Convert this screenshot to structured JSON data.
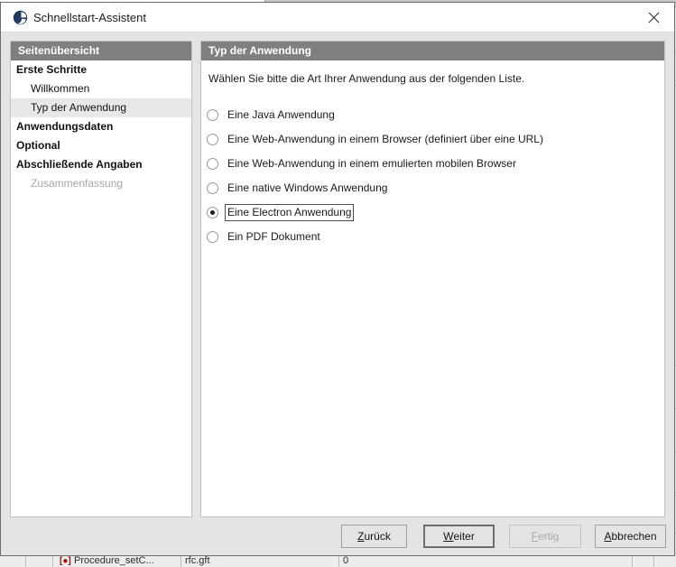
{
  "window": {
    "title": "Schnellstart-Assistent",
    "icon": "app-moon-icon",
    "close_label": "✕"
  },
  "sidebar": {
    "header": "Seitenübersicht",
    "items": [
      {
        "label": "Erste Schritte",
        "type": "group",
        "state": "normal"
      },
      {
        "label": "Willkommen",
        "type": "child",
        "state": "normal"
      },
      {
        "label": "Typ der Anwendung",
        "type": "child",
        "state": "current"
      },
      {
        "label": "Anwendungsdaten",
        "type": "group",
        "state": "normal"
      },
      {
        "label": "Optional",
        "type": "group",
        "state": "normal"
      },
      {
        "label": "Abschließende Angaben",
        "type": "group",
        "state": "normal"
      },
      {
        "label": "Zusammenfassung",
        "type": "child",
        "state": "disabled"
      }
    ]
  },
  "main": {
    "header": "Typ der Anwendung",
    "instruction": "Wählen Sie bitte die Art Ihrer Anwendung aus der folgenden Liste.",
    "options": [
      {
        "label": "Eine Java Anwendung",
        "selected": false,
        "focused": false
      },
      {
        "label": "Eine Web-Anwendung in einem Browser (definiert über eine URL)",
        "selected": false,
        "focused": false
      },
      {
        "label": "Eine Web-Anwendung in einem emulierten mobilen Browser",
        "selected": false,
        "focused": false
      },
      {
        "label": "Eine native Windows Anwendung",
        "selected": false,
        "focused": false
      },
      {
        "label": "Eine Electron Anwendung",
        "selected": true,
        "focused": true
      },
      {
        "label": "Ein PDF Dokument",
        "selected": false,
        "focused": false
      }
    ]
  },
  "buttons": {
    "back": {
      "mnemonic": "Z",
      "rest": "urück",
      "state": "enabled",
      "default": false
    },
    "next": {
      "mnemonic": "W",
      "rest": "eiter",
      "state": "enabled",
      "default": true
    },
    "finish": {
      "mnemonic": "F",
      "rest": "ertig",
      "state": "disabled",
      "default": false
    },
    "cancel": {
      "mnemonic": "A",
      "rest": "bbrechen",
      "state": "enabled",
      "default": false
    }
  },
  "background": {
    "bottom_row_text_1": "Procedure_setC...",
    "bottom_row_text_2": "rfc.gft",
    "bottom_row_text_3": "0"
  },
  "colors": {
    "panel_header": "#808080",
    "current_row": "#e8e8e8",
    "dialog_face": "#e4e4e4",
    "accent_icon": "#1f3864"
  }
}
